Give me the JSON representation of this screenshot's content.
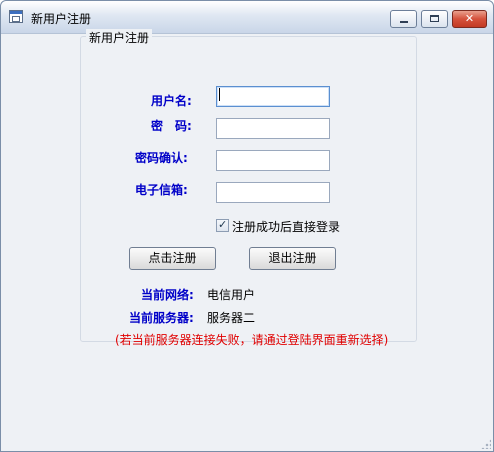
{
  "window": {
    "title": "新用户注册"
  },
  "form": {
    "group_title": "新用户注册",
    "username_label": "用户名:",
    "username_value": "",
    "password_label": "密　码:",
    "password_value": "",
    "confirm_label": "密码确认:",
    "confirm_value": "",
    "email_label": "电子信箱:",
    "email_value": "",
    "auto_login_label": "注册成功后直接登录",
    "auto_login_checked": true,
    "register_button": "点击注册",
    "exit_button": "退出注册"
  },
  "info": {
    "network_label": "当前网络:",
    "network_value": "电信用户",
    "server_label": "当前服务器:",
    "server_value": "服务器二",
    "warning": "(若当前服务器连接失败，请通过登陆界面重新选择)"
  },
  "colors": {
    "label_blue": "#0000c8",
    "warning_red": "#e00000",
    "background": "#eef1f5"
  }
}
